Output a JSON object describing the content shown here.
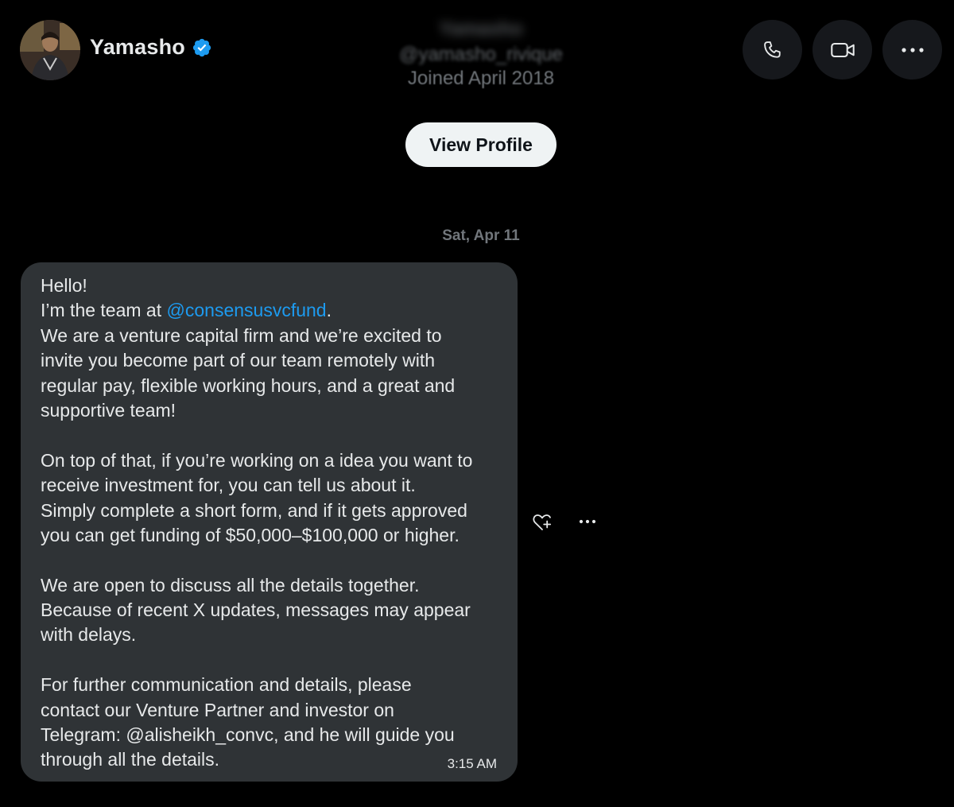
{
  "header": {
    "username": "Yamasho",
    "profile_name": "Yamasho",
    "handle": "@yamasho_rivique",
    "joined": "Joined April 2018",
    "view_profile_label": "View Profile"
  },
  "conversation": {
    "date_separator": "Sat, Apr 11",
    "message": {
      "time": "3:15 AM",
      "line1": "Hello!",
      "line2_prefix": "I’m the team at ",
      "line2_mention": "@consensusvcfund",
      "line2_suffix": ".",
      "line3": "We are a venture capital firm and we’re excited to",
      "line4": "invite you become part of our team remotely with",
      "line5": "regular pay, flexible working hours, and a great and",
      "line6": "supportive team!",
      "line7": "On top of that, if you’re working on a idea you want to",
      "line8": "receive investment for, you can tell us about it.",
      "line9": "Simply complete a short form, and if it gets approved",
      "line10": "you can get funding of $50,000–$100,000 or higher.",
      "line11": "We are open to discuss all the details together.",
      "line12": "Because of recent X updates, messages may appear",
      "line13": "with delays.",
      "line14": "For further communication and details, please",
      "line15": "contact our Venture Partner and investor  on",
      "line16": "Telegram: @alisheikh_convc, and he will guide you",
      "line17": "through all the details."
    }
  },
  "icons": {
    "verified": "verified-badge-icon",
    "call": "phone-icon",
    "video": "video-camera-icon",
    "more": "more-horizontal-icon",
    "react": "heart-plus-icon"
  },
  "colors": {
    "background": "#000000",
    "bubble": "#2f3336",
    "accent": "#1d9bf0",
    "text": "#e7e9ea",
    "muted": "#71767b",
    "button_bg": "#16181c",
    "view_profile_bg": "#eff3f4"
  }
}
